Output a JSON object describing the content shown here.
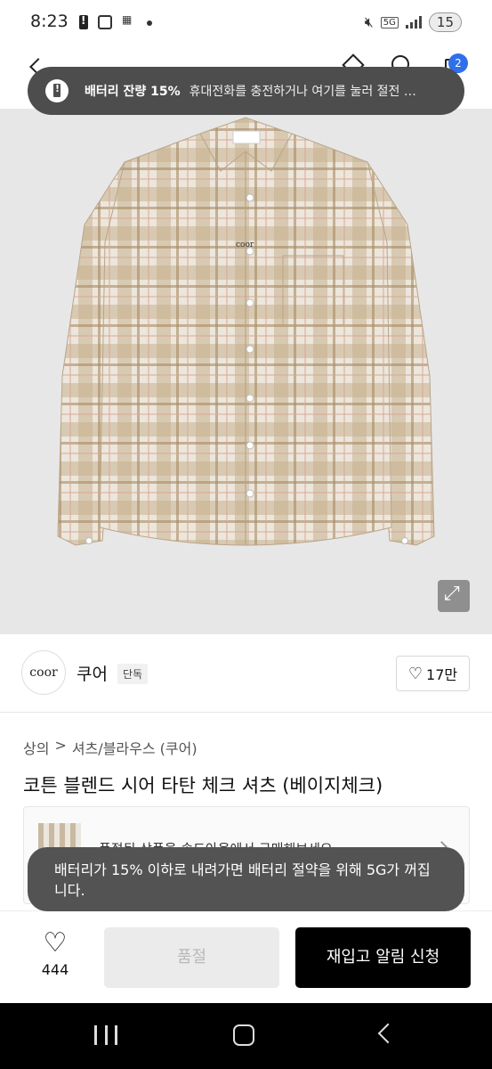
{
  "status_bar": {
    "time": "8:23",
    "network": "5G",
    "battery": "15"
  },
  "header": {
    "cart_count": "2"
  },
  "battery_banner": {
    "title": "배터리 잔량 15%",
    "text": "휴대전화를 충전하거나 여기를 눌러 절전 …"
  },
  "product_image": {
    "label_tag": "coor"
  },
  "brand": {
    "logo_text": "coor",
    "name": "쿠어",
    "badge": "단독",
    "likes": "17만"
  },
  "breadcrumb": {
    "category": "상의",
    "separator": ">",
    "subcategory": "셔츠/블라우스 (쿠어)"
  },
  "product": {
    "title": "코튼 블렌드 시어 타탄 체크 셔츠 (베이지체크)"
  },
  "soldout_card": {
    "text": "품절된 상품을 솔드아웃에서 구매해보세요."
  },
  "toast": {
    "text": "배터리가 15% 이하로 내려가면 배터리 절약을 위해 5G가 꺼집니다."
  },
  "action_bar": {
    "wish_count": "444",
    "soldout_label": "품절",
    "restock_label": "재입고 알림 신청"
  },
  "colors": {
    "accent_badge": "#2f6fea",
    "primary_button": "#000000",
    "disabled_button": "#ebebeb",
    "shirt_base": "#e9e2d6",
    "shirt_check": "#b89a74"
  }
}
